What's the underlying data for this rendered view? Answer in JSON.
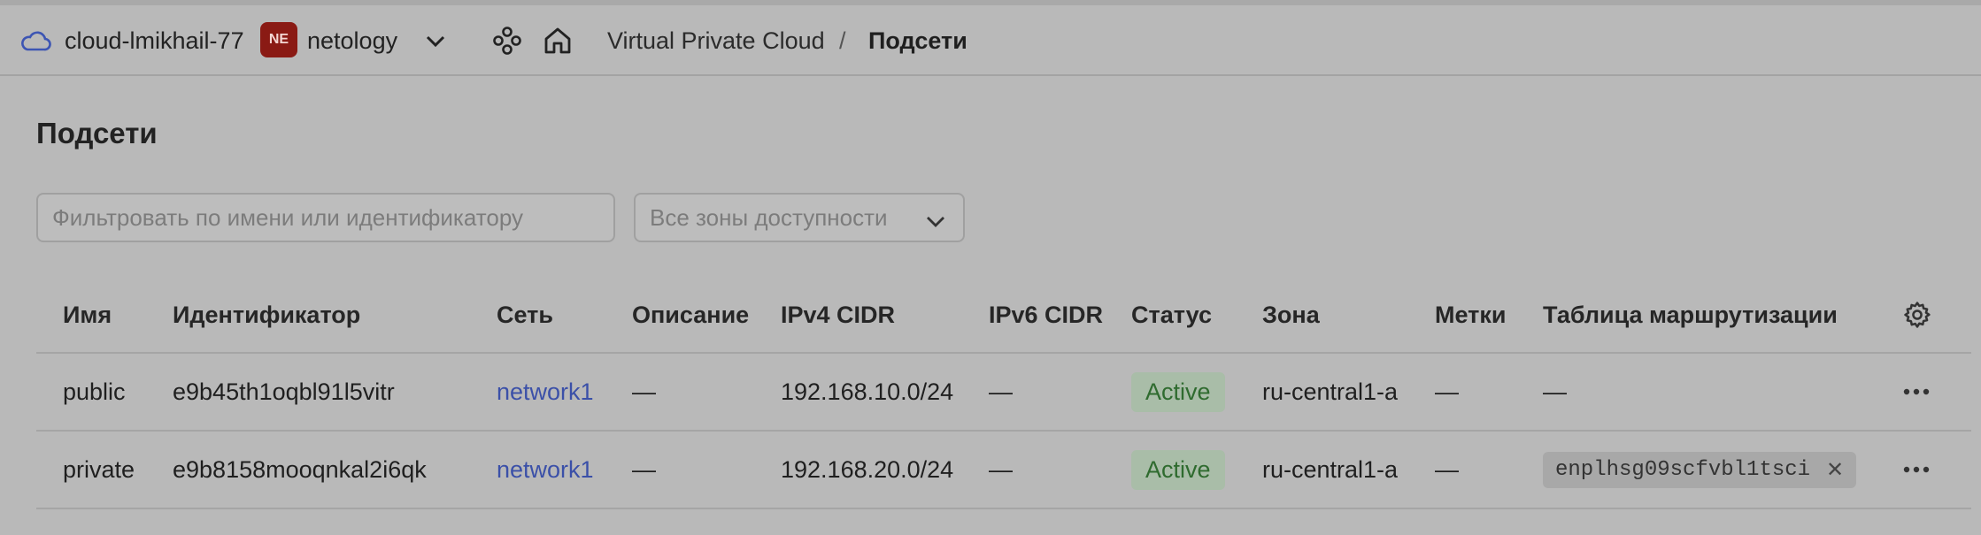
{
  "header": {
    "cloud_name": "cloud-lmikhail-77",
    "org_badge": "NE",
    "org_name": "netology",
    "breadcrumb": [
      "Virtual Private Cloud",
      "/",
      "Подсети"
    ]
  },
  "page": {
    "title": "Подсети",
    "filter_placeholder": "Фильтровать по имени или идентификатору",
    "zone_select_value": "Все зоны доступности"
  },
  "table": {
    "columns": [
      "Имя",
      "Идентификатор",
      "Сеть",
      "Описание",
      "IPv4 CIDR",
      "IPv6 CIDR",
      "Статус",
      "Зона",
      "Метки",
      "Таблица маршрутизации"
    ],
    "rows": [
      {
        "name": "public",
        "id": "e9b45th1oqbl91l5vitr",
        "network": "network1",
        "description": "—",
        "ipv4": "192.168.10.0/24",
        "ipv6": "—",
        "status": "Active",
        "zone": "ru-central1-a",
        "labels": "—",
        "route_table": "—"
      },
      {
        "name": "private",
        "id": "e9b8158mooqnkal2i6qk",
        "network": "network1",
        "description": "—",
        "ipv4": "192.168.20.0/24",
        "ipv6": "—",
        "status": "Active",
        "zone": "ru-central1-a",
        "labels": "—",
        "route_table": "enplhsg09scfvbl1tsci",
        "route_table_remove": "✕"
      }
    ]
  },
  "colors": {
    "background": "#b9b9b9",
    "link": "#3b50a8",
    "status_active_bg": "#a9bda8",
    "status_active_text": "#2f6b2f",
    "org_badge_bg": "#8a1a14"
  }
}
